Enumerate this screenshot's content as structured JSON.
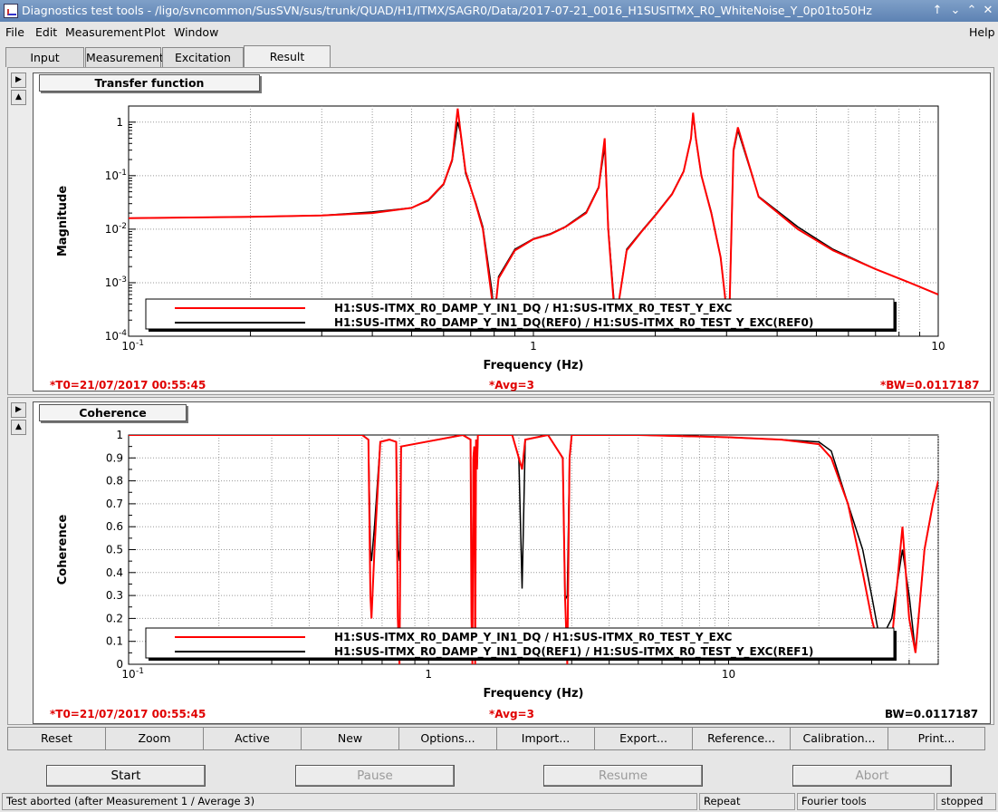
{
  "window": {
    "title": "Diagnostics test tools - /ligo/svncommon/SusSVN/sus/trunk/QUAD/H1/ITMX/SAGR0/Data/2017-07-21_0016_H1SUSITMX_R0_WhiteNoise_Y_0p01to50Hz"
  },
  "menu": {
    "file": "File",
    "edit": "Edit",
    "measurement": "Measurement",
    "plot": "Plot",
    "window": "Window",
    "help": "Help"
  },
  "tabs": {
    "input": "Input",
    "measurement": "Measurement",
    "excitation": "Excitation",
    "result": "Result"
  },
  "plot1": {
    "label": "Transfer function",
    "xlabel": "Frequency (Hz)",
    "ylabel": "Magnitude",
    "legend": [
      {
        "name": "H1:SUS-ITMX_R0_DAMP_Y_IN1_DQ / H1:SUS-ITMX_R0_TEST_Y_EXC",
        "color": "#ff0000"
      },
      {
        "name": "H1:SUS-ITMX_R0_DAMP_Y_IN1_DQ(REF0) / H1:SUS-ITMX_R0_TEST_Y_EXC(REF0)",
        "color": "#000000"
      }
    ],
    "t0": "*T0=21/07/2017 00:55:45",
    "avg": "*Avg=3",
    "bw": "*BW=0.0117187"
  },
  "plot2": {
    "label": "Coherence",
    "xlabel": "Frequency (Hz)",
    "ylabel": "Coherence",
    "legend": [
      {
        "name": "H1:SUS-ITMX_R0_DAMP_Y_IN1_DQ / H1:SUS-ITMX_R0_TEST_Y_EXC",
        "color": "#ff0000"
      },
      {
        "name": "H1:SUS-ITMX_R0_DAMP_Y_IN1_DQ(REF1) / H1:SUS-ITMX_R0_TEST_Y_EXC(REF1)",
        "color": "#000000"
      }
    ],
    "t0": "*T0=21/07/2017 00:55:45",
    "avg": "*Avg=3",
    "bw": "BW=0.0117187"
  },
  "chart_data": [
    {
      "type": "line",
      "title": "Transfer function",
      "xlabel": "Frequency (Hz)",
      "ylabel": "Magnitude",
      "xscale": "log",
      "yscale": "log",
      "xlim": [
        0.1,
        10
      ],
      "ylim": [
        0.0001,
        2
      ],
      "xticks": [
        {
          "v": 0.1,
          "label": "10",
          "exp": "-1"
        },
        {
          "v": 1,
          "label": "1",
          "exp": ""
        },
        {
          "v": 10,
          "label": "10",
          "exp": ""
        }
      ],
      "yticks": [
        {
          "v": 1,
          "label": "1",
          "exp": ""
        },
        {
          "v": 0.1,
          "label": "10",
          "exp": "-1"
        },
        {
          "v": 0.01,
          "label": "10",
          "exp": "-2"
        },
        {
          "v": 0.001,
          "label": "10",
          "exp": "-3"
        },
        {
          "v": 0.0001,
          "label": "10",
          "exp": "-4"
        }
      ],
      "grid": true,
      "legend_position": "bottom",
      "series": [
        {
          "name": "H1:SUS-ITMX_R0_DAMP_Y_IN1_DQ / H1:SUS-ITMX_R0_TEST_Y_EXC",
          "color": "#ff0000",
          "x": [
            0.1,
            0.2,
            0.3,
            0.4,
            0.5,
            0.55,
            0.6,
            0.63,
            0.65,
            0.66,
            0.68,
            0.72,
            0.75,
            0.79,
            0.8,
            0.82,
            0.9,
            1.0,
            1.1,
            1.2,
            1.35,
            1.45,
            1.5,
            1.53,
            1.58,
            1.6,
            1.7,
            1.85,
            2.0,
            2.2,
            2.35,
            2.45,
            2.48,
            2.52,
            2.6,
            2.75,
            2.9,
            3.0,
            3.05,
            3.12,
            3.2,
            3.6,
            4.5,
            5.5,
            7,
            8.5,
            10
          ],
          "y": [
            0.016,
            0.017,
            0.018,
            0.02,
            0.025,
            0.035,
            0.07,
            0.2,
            1.8,
            0.7,
            0.12,
            0.03,
            0.01,
            0.0005,
            0.0002,
            0.0012,
            0.004,
            0.0065,
            0.008,
            0.011,
            0.02,
            0.06,
            0.5,
            0.01,
            0.0004,
            0.0002,
            0.004,
            0.009,
            0.018,
            0.045,
            0.12,
            0.5,
            1.5,
            0.5,
            0.1,
            0.02,
            0.003,
            0.0003,
            0.0003,
            0.3,
            0.8,
            0.04,
            0.01,
            0.004,
            0.0018,
            0.001,
            0.0006
          ]
        },
        {
          "name": "H1:SUS-ITMX_R0_DAMP_Y_IN1_DQ(REF0) / H1:SUS-ITMX_R0_TEST_Y_EXC(REF0)",
          "color": "#000000",
          "x": [
            0.1,
            0.2,
            0.3,
            0.4,
            0.5,
            0.55,
            0.6,
            0.63,
            0.65,
            0.66,
            0.68,
            0.72,
            0.75,
            0.79,
            0.8,
            0.82,
            0.9,
            1.0,
            1.1,
            1.2,
            1.35,
            1.45,
            1.5,
            1.53,
            1.58,
            1.6,
            1.7,
            1.85,
            2.0,
            2.2,
            2.35,
            2.45,
            2.48,
            2.52,
            2.6,
            2.75,
            2.9,
            3.0,
            3.05,
            3.12,
            3.2,
            3.6,
            4.5,
            5.5,
            7,
            8.5,
            10
          ],
          "y": [
            0.016,
            0.017,
            0.018,
            0.021,
            0.025,
            0.034,
            0.068,
            0.19,
            1.0,
            0.65,
            0.11,
            0.032,
            0.011,
            0.0007,
            0.0002,
            0.0013,
            0.0042,
            0.0066,
            0.0082,
            0.0112,
            0.021,
            0.062,
            0.35,
            0.011,
            0.0005,
            0.0002,
            0.0042,
            0.0092,
            0.0185,
            0.046,
            0.122,
            0.49,
            1.4,
            0.48,
            0.1,
            0.021,
            0.003,
            0.0003,
            0.0003,
            0.28,
            0.7,
            0.041,
            0.011,
            0.0042,
            0.0018,
            0.001,
            0.0006
          ]
        }
      ]
    },
    {
      "type": "line",
      "title": "Coherence",
      "xlabel": "Frequency (Hz)",
      "ylabel": "Coherence",
      "xscale": "log",
      "yscale": "linear",
      "xlim": [
        0.1,
        50
      ],
      "ylim": [
        0,
        1
      ],
      "xticks": [
        {
          "v": 0.1,
          "label": "10",
          "exp": "-1"
        },
        {
          "v": 1,
          "label": "1",
          "exp": ""
        },
        {
          "v": 10,
          "label": "10",
          "exp": ""
        }
      ],
      "yticks": [
        {
          "v": 1,
          "label": "1"
        },
        {
          "v": 0.9,
          "label": "0.9"
        },
        {
          "v": 0.8,
          "label": "0.8"
        },
        {
          "v": 0.7,
          "label": "0.7"
        },
        {
          "v": 0.6,
          "label": "0.6"
        },
        {
          "v": 0.5,
          "label": "0.5"
        },
        {
          "v": 0.4,
          "label": "0.4"
        },
        {
          "v": 0.3,
          "label": "0.3"
        },
        {
          "v": 0.2,
          "label": "0.2"
        },
        {
          "v": 0.1,
          "label": "0.1"
        },
        {
          "v": 0,
          "label": "0"
        }
      ],
      "grid": true,
      "legend_position": "bottom",
      "series": [
        {
          "name": "H1:SUS-ITMX_R0_DAMP_Y_IN1_DQ / H1:SUS-ITMX_R0_TEST_Y_EXC",
          "color": "#ff0000",
          "x": [
            0.1,
            0.3,
            0.6,
            0.63,
            0.64,
            0.645,
            0.66,
            0.69,
            0.74,
            0.78,
            0.79,
            0.8,
            0.81,
            1.3,
            1.38,
            1.39,
            1.4,
            1.41,
            1.42,
            1.43,
            1.44,
            1.45,
            1.46,
            1.9,
            2.0,
            2.05,
            2.1,
            2.5,
            2.8,
            2.85,
            2.9,
            2.95,
            3.0,
            5,
            10,
            15,
            20,
            22,
            25,
            28,
            30,
            32,
            35,
            38,
            40,
            42,
            45,
            48,
            50
          ],
          "y": [
            1,
            1,
            1,
            0.98,
            0.3,
            0.2,
            0.5,
            0.97,
            0.98,
            0.97,
            0.2,
            0.0,
            0.95,
            1,
            0.98,
            0.2,
            0.0,
            0.9,
            0.95,
            0.0,
            0.98,
            0.85,
            1,
            1,
            0.9,
            0.85,
            0.98,
            1,
            0.9,
            0.3,
            0.0,
            0.9,
            1,
            1,
            0.99,
            0.98,
            0.96,
            0.9,
            0.7,
            0.4,
            0.2,
            0.05,
            0.1,
            0.6,
            0.2,
            0.05,
            0.5,
            0.7,
            0.8
          ]
        },
        {
          "name": "H1:SUS-ITMX_R0_DAMP_Y_IN1_DQ(REF1) / H1:SUS-ITMX_R0_TEST_Y_EXC(REF1)",
          "color": "#000000",
          "x": [
            0.1,
            0.3,
            0.6,
            0.63,
            0.64,
            0.645,
            0.66,
            0.69,
            0.74,
            0.78,
            0.79,
            0.8,
            0.81,
            1.3,
            1.38,
            1.39,
            1.4,
            1.41,
            1.42,
            1.43,
            1.44,
            1.45,
            1.46,
            1.9,
            2.0,
            2.05,
            2.1,
            2.5,
            2.8,
            2.85,
            2.9,
            2.95,
            3.0,
            5,
            10,
            15,
            20,
            22,
            25,
            28,
            30,
            32,
            35,
            38,
            40,
            42,
            45,
            48,
            50
          ],
          "y": [
            1,
            1,
            1,
            0.98,
            0.5,
            0.45,
            0.6,
            0.97,
            0.98,
            0.97,
            0.5,
            0.45,
            0.95,
            1,
            0.98,
            0.35,
            0.3,
            0.9,
            0.95,
            0.3,
            0.98,
            0.85,
            1,
            1,
            0.9,
            0.33,
            0.98,
            1,
            0.9,
            0.28,
            0.3,
            0.9,
            1,
            1,
            0.99,
            0.98,
            0.97,
            0.93,
            0.7,
            0.5,
            0.3,
            0.1,
            0.2,
            0.5,
            0.3,
            0.05,
            0.5,
            0.7,
            0.8
          ]
        }
      ]
    }
  ],
  "buttons": {
    "reset": "Reset",
    "zoom": "Zoom",
    "active": "Active",
    "new": "New",
    "options": "Options...",
    "import": "Import...",
    "export": "Export...",
    "reference": "Reference...",
    "calibration": "Calibration...",
    "print": "Print..."
  },
  "control": {
    "start": "Start",
    "pause": "Pause",
    "resume": "Resume",
    "abort": "Abort"
  },
  "status": {
    "message": "Test aborted (after Measurement 1 / Average 3)",
    "repeat": "Repeat",
    "fourier": "Fourier tools",
    "state": "stopped"
  }
}
